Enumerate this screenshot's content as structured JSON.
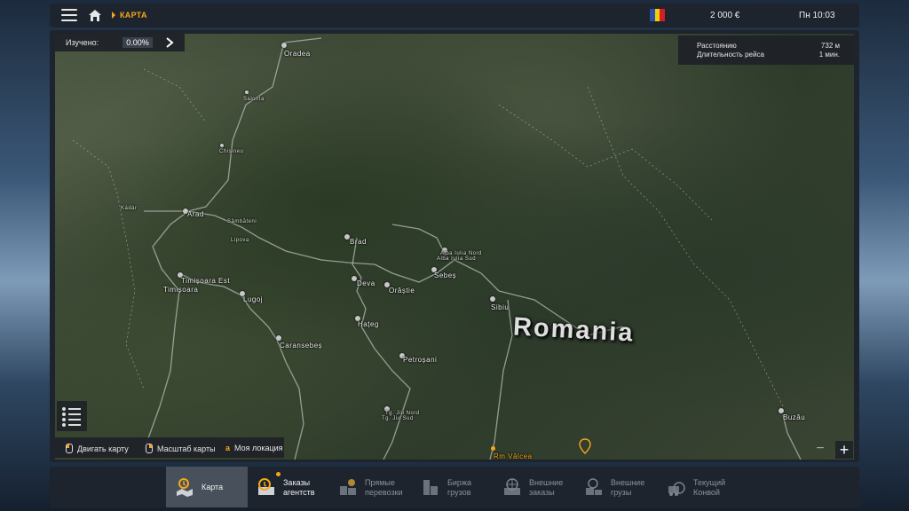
{
  "topbar": {
    "breadcrumb": "КАРТА",
    "money": "2 000 €",
    "clock": "Пн 10:03",
    "flag_colors": [
      "#2b4fa8",
      "#f5d000",
      "#d31e25"
    ],
    "accent": "#f3a81c"
  },
  "explored": {
    "label": "Изучено:",
    "value": "0.00%"
  },
  "route": {
    "distance_label": "Расстоянию",
    "distance_value": "732 м",
    "duration_label": "Длительность рейса",
    "duration_value": "1 мин."
  },
  "map": {
    "country": "Romania",
    "cities": {
      "oradea": "Oradea",
      "salonta": "Salonta",
      "chisineu": "Chișineu",
      "kadar": "Kádár",
      "arad": "Arad",
      "sambateni": "Sâmbăteni",
      "lipova": "Lipova",
      "brad": "Brad",
      "alba_nord": "Alba Iulia Nord",
      "alba_sud": "Alba Iulia Sud",
      "timisoara_est": "Timișoara Est",
      "timisoara": "Timișoara",
      "deva": "Deva",
      "orastie": "Orăștie",
      "sebes": "Sebeș",
      "lugoj": "Lugoj",
      "sibiu": "Sibiu",
      "hateg": "Hațeg",
      "caransebes": "Caransebeș",
      "petrosani": "Petroșani",
      "tgjiu_nord": "Tg. Jiu Nord",
      "tgjiu_sud": "Tg. Jiu Sud",
      "buzau": "Buzău",
      "rm_valcea": "Rm Vâlcea"
    }
  },
  "hints": {
    "move": "Двигать карту",
    "zoom": "Масштаб карты",
    "key": "a",
    "locate": "Моя локация"
  },
  "zoom": {
    "minus": "−",
    "plus": "+"
  },
  "nav": [
    {
      "line1": "Карта",
      "line2": "",
      "icon": "map-icon"
    },
    {
      "line1": "Заказы",
      "line2": "агентств",
      "icon": "agency-orders-icon"
    },
    {
      "line1": "Прямые",
      "line2": "перевозки",
      "icon": "direct-transport-icon"
    },
    {
      "line1": "Биржа",
      "line2": "грузов",
      "icon": "cargo-exchange-icon"
    },
    {
      "line1": "Внешние",
      "line2": "заказы",
      "icon": "external-orders-icon"
    },
    {
      "line1": "Внешние",
      "line2": "грузы",
      "icon": "external-cargo-icon"
    },
    {
      "line1": "Текущий",
      "line2": "Конвой",
      "icon": "convoy-icon"
    }
  ]
}
